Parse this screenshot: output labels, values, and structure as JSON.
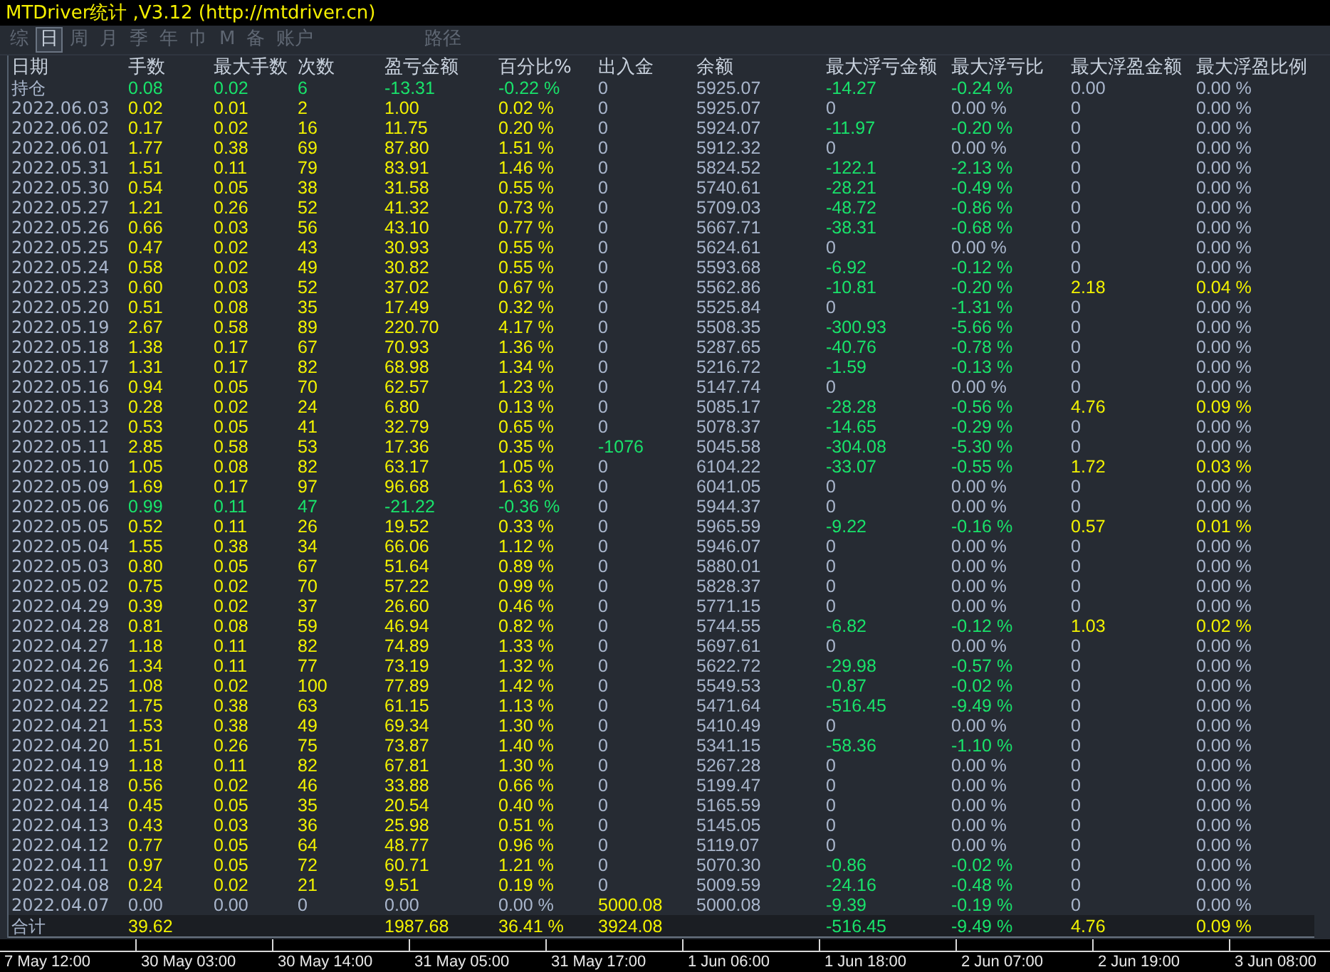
{
  "window": {
    "title": "MTDriver统计 ,V3.12 (http://mtdriver.cn)"
  },
  "toolbar": {
    "items": [
      {
        "label": "综",
        "selected": false
      },
      {
        "label": "日",
        "selected": true
      },
      {
        "label": "周",
        "selected": false
      },
      {
        "label": "月",
        "selected": false
      },
      {
        "label": "季",
        "selected": false
      },
      {
        "label": "年",
        "selected": false
      },
      {
        "label": "巾",
        "selected": false
      },
      {
        "label": "M",
        "selected": false
      },
      {
        "label": "备",
        "selected": false
      },
      {
        "label": "账户",
        "selected": false
      }
    ],
    "path_button": {
      "label": "路径",
      "selected": false
    }
  },
  "table": {
    "columns": [
      "日期",
      "手数",
      "最大手数",
      "次数",
      "盈亏金额",
      "百分比%",
      "出入金",
      "余额",
      "最大浮亏金额",
      "最大浮亏比",
      "最大浮盈金额",
      "最大浮盈比例"
    ],
    "rows": [
      {
        "cells": [
          {
            "text": "持仓"
          },
          {
            "text": "0.08",
            "color": "#19e36b"
          },
          {
            "text": "0.02",
            "color": "#19e36b"
          },
          {
            "text": "6",
            "color": "#19e36b"
          },
          {
            "text": "-13.31",
            "color": "#19e36b"
          },
          {
            "text": "-0.22 %",
            "color": "#19e36b"
          },
          {
            "text": "0"
          },
          {
            "text": "5925.07"
          },
          {
            "text": "-14.27",
            "color": "#19e36b"
          },
          {
            "text": "-0.24 %",
            "color": "#19e36b"
          },
          {
            "text": "0.00"
          },
          {
            "text": "0.00 %"
          }
        ]
      },
      {
        "cells": [
          {
            "text": "2022.06.03"
          },
          {
            "text": "0.02",
            "color": "#f2f200"
          },
          {
            "text": "0.01",
            "color": "#f2f200"
          },
          {
            "text": "2",
            "color": "#f2f200"
          },
          {
            "text": "1.00",
            "color": "#f2f200"
          },
          {
            "text": "0.02 %",
            "color": "#f2f200"
          },
          {
            "text": "0"
          },
          {
            "text": "5925.07"
          },
          {
            "text": "0"
          },
          {
            "text": "0.00 %"
          },
          {
            "text": "0"
          },
          {
            "text": "0.00 %"
          }
        ]
      },
      {
        "cells": [
          {
            "text": "2022.06.02"
          },
          {
            "text": "0.17",
            "color": "#f2f200"
          },
          {
            "text": "0.02",
            "color": "#f2f200"
          },
          {
            "text": "16",
            "color": "#f2f200"
          },
          {
            "text": "11.75",
            "color": "#f2f200"
          },
          {
            "text": "0.20 %",
            "color": "#f2f200"
          },
          {
            "text": "0"
          },
          {
            "text": "5924.07"
          },
          {
            "text": "-11.97",
            "color": "#19e36b"
          },
          {
            "text": "-0.20 %",
            "color": "#19e36b"
          },
          {
            "text": "0"
          },
          {
            "text": "0.00 %"
          }
        ]
      },
      {
        "cells": [
          {
            "text": "2022.06.01"
          },
          {
            "text": "1.77",
            "color": "#f2f200"
          },
          {
            "text": "0.38",
            "color": "#f2f200"
          },
          {
            "text": "69",
            "color": "#f2f200"
          },
          {
            "text": "87.80",
            "color": "#f2f200"
          },
          {
            "text": "1.51 %",
            "color": "#f2f200"
          },
          {
            "text": "0"
          },
          {
            "text": "5912.32"
          },
          {
            "text": "0"
          },
          {
            "text": "0.00 %"
          },
          {
            "text": "0"
          },
          {
            "text": "0.00 %"
          }
        ]
      },
      {
        "cells": [
          {
            "text": "2022.05.31"
          },
          {
            "text": "1.51",
            "color": "#f2f200"
          },
          {
            "text": "0.11",
            "color": "#f2f200"
          },
          {
            "text": "79",
            "color": "#f2f200"
          },
          {
            "text": "83.91",
            "color": "#f2f200"
          },
          {
            "text": "1.46 %",
            "color": "#f2f200"
          },
          {
            "text": "0"
          },
          {
            "text": "5824.52"
          },
          {
            "text": "-122.1",
            "color": "#19e36b"
          },
          {
            "text": "-2.13 %",
            "color": "#19e36b"
          },
          {
            "text": "0"
          },
          {
            "text": "0.00 %"
          }
        ]
      },
      {
        "cells": [
          {
            "text": "2022.05.30"
          },
          {
            "text": "0.54",
            "color": "#f2f200"
          },
          {
            "text": "0.05",
            "color": "#f2f200"
          },
          {
            "text": "38",
            "color": "#f2f200"
          },
          {
            "text": "31.58",
            "color": "#f2f200"
          },
          {
            "text": "0.55 %",
            "color": "#f2f200"
          },
          {
            "text": "0"
          },
          {
            "text": "5740.61"
          },
          {
            "text": "-28.21",
            "color": "#19e36b"
          },
          {
            "text": "-0.49 %",
            "color": "#19e36b"
          },
          {
            "text": "0"
          },
          {
            "text": "0.00 %"
          }
        ]
      },
      {
        "cells": [
          {
            "text": "2022.05.27"
          },
          {
            "text": "1.21",
            "color": "#f2f200"
          },
          {
            "text": "0.26",
            "color": "#f2f200"
          },
          {
            "text": "52",
            "color": "#f2f200"
          },
          {
            "text": "41.32",
            "color": "#f2f200"
          },
          {
            "text": "0.73 %",
            "color": "#f2f200"
          },
          {
            "text": "0"
          },
          {
            "text": "5709.03"
          },
          {
            "text": "-48.72",
            "color": "#19e36b"
          },
          {
            "text": "-0.86 %",
            "color": "#19e36b"
          },
          {
            "text": "0"
          },
          {
            "text": "0.00 %"
          }
        ]
      },
      {
        "cells": [
          {
            "text": "2022.05.26"
          },
          {
            "text": "0.66",
            "color": "#f2f200"
          },
          {
            "text": "0.03",
            "color": "#f2f200"
          },
          {
            "text": "56",
            "color": "#f2f200"
          },
          {
            "text": "43.10",
            "color": "#f2f200"
          },
          {
            "text": "0.77 %",
            "color": "#f2f200"
          },
          {
            "text": "0"
          },
          {
            "text": "5667.71"
          },
          {
            "text": "-38.31",
            "color": "#19e36b"
          },
          {
            "text": "-0.68 %",
            "color": "#19e36b"
          },
          {
            "text": "0"
          },
          {
            "text": "0.00 %"
          }
        ]
      },
      {
        "cells": [
          {
            "text": "2022.05.25"
          },
          {
            "text": "0.47",
            "color": "#f2f200"
          },
          {
            "text": "0.02",
            "color": "#f2f200"
          },
          {
            "text": "43",
            "color": "#f2f200"
          },
          {
            "text": "30.93",
            "color": "#f2f200"
          },
          {
            "text": "0.55 %",
            "color": "#f2f200"
          },
          {
            "text": "0"
          },
          {
            "text": "5624.61"
          },
          {
            "text": "0"
          },
          {
            "text": "0.00 %"
          },
          {
            "text": "0"
          },
          {
            "text": "0.00 %"
          }
        ]
      },
      {
        "cells": [
          {
            "text": "2022.05.24"
          },
          {
            "text": "0.58",
            "color": "#f2f200"
          },
          {
            "text": "0.02",
            "color": "#f2f200"
          },
          {
            "text": "49",
            "color": "#f2f200"
          },
          {
            "text": "30.82",
            "color": "#f2f200"
          },
          {
            "text": "0.55 %",
            "color": "#f2f200"
          },
          {
            "text": "0"
          },
          {
            "text": "5593.68"
          },
          {
            "text": "-6.92",
            "color": "#19e36b"
          },
          {
            "text": "-0.12 %",
            "color": "#19e36b"
          },
          {
            "text": "0"
          },
          {
            "text": "0.00 %"
          }
        ]
      },
      {
        "cells": [
          {
            "text": "2022.05.23"
          },
          {
            "text": "0.60",
            "color": "#f2f200"
          },
          {
            "text": "0.03",
            "color": "#f2f200"
          },
          {
            "text": "52",
            "color": "#f2f200"
          },
          {
            "text": "37.02",
            "color": "#f2f200"
          },
          {
            "text": "0.67 %",
            "color": "#f2f200"
          },
          {
            "text": "0"
          },
          {
            "text": "5562.86"
          },
          {
            "text": "-10.81",
            "color": "#19e36b"
          },
          {
            "text": "-0.20 %",
            "color": "#19e36b"
          },
          {
            "text": "2.18",
            "color": "#f2f200"
          },
          {
            "text": "0.04 %",
            "color": "#f2f200"
          }
        ]
      },
      {
        "cells": [
          {
            "text": "2022.05.20"
          },
          {
            "text": "0.51",
            "color": "#f2f200"
          },
          {
            "text": "0.08",
            "color": "#f2f200"
          },
          {
            "text": "35",
            "color": "#f2f200"
          },
          {
            "text": "17.49",
            "color": "#f2f200"
          },
          {
            "text": "0.32 %",
            "color": "#f2f200"
          },
          {
            "text": "0"
          },
          {
            "text": "5525.84"
          },
          {
            "text": "0"
          },
          {
            "text": "-1.31 %",
            "color": "#19e36b"
          },
          {
            "text": "0"
          },
          {
            "text": "0.00 %"
          }
        ]
      },
      {
        "cells": [
          {
            "text": "2022.05.19"
          },
          {
            "text": "2.67",
            "color": "#f2f200"
          },
          {
            "text": "0.58",
            "color": "#f2f200"
          },
          {
            "text": "89",
            "color": "#f2f200"
          },
          {
            "text": "220.70",
            "color": "#f2f200"
          },
          {
            "text": "4.17 %",
            "color": "#f2f200"
          },
          {
            "text": "0"
          },
          {
            "text": "5508.35"
          },
          {
            "text": "-300.93",
            "color": "#19e36b"
          },
          {
            "text": "-5.66 %",
            "color": "#19e36b"
          },
          {
            "text": "0"
          },
          {
            "text": "0.00 %"
          }
        ]
      },
      {
        "cells": [
          {
            "text": "2022.05.18"
          },
          {
            "text": "1.38",
            "color": "#f2f200"
          },
          {
            "text": "0.17",
            "color": "#f2f200"
          },
          {
            "text": "67",
            "color": "#f2f200"
          },
          {
            "text": "70.93",
            "color": "#f2f200"
          },
          {
            "text": "1.36 %",
            "color": "#f2f200"
          },
          {
            "text": "0"
          },
          {
            "text": "5287.65"
          },
          {
            "text": "-40.76",
            "color": "#19e36b"
          },
          {
            "text": "-0.78 %",
            "color": "#19e36b"
          },
          {
            "text": "0"
          },
          {
            "text": "0.00 %"
          }
        ]
      },
      {
        "cells": [
          {
            "text": "2022.05.17"
          },
          {
            "text": "1.31",
            "color": "#f2f200"
          },
          {
            "text": "0.17",
            "color": "#f2f200"
          },
          {
            "text": "82",
            "color": "#f2f200"
          },
          {
            "text": "68.98",
            "color": "#f2f200"
          },
          {
            "text": "1.34 %",
            "color": "#f2f200"
          },
          {
            "text": "0"
          },
          {
            "text": "5216.72"
          },
          {
            "text": "-1.59",
            "color": "#19e36b"
          },
          {
            "text": "-0.13 %",
            "color": "#19e36b"
          },
          {
            "text": "0"
          },
          {
            "text": "0.00 %"
          }
        ]
      },
      {
        "cells": [
          {
            "text": "2022.05.16"
          },
          {
            "text": "0.94",
            "color": "#f2f200"
          },
          {
            "text": "0.05",
            "color": "#f2f200"
          },
          {
            "text": "70",
            "color": "#f2f200"
          },
          {
            "text": "62.57",
            "color": "#f2f200"
          },
          {
            "text": "1.23 %",
            "color": "#f2f200"
          },
          {
            "text": "0"
          },
          {
            "text": "5147.74"
          },
          {
            "text": "0"
          },
          {
            "text": "0.00 %"
          },
          {
            "text": "0"
          },
          {
            "text": "0.00 %"
          }
        ]
      },
      {
        "cells": [
          {
            "text": "2022.05.13"
          },
          {
            "text": "0.28",
            "color": "#f2f200"
          },
          {
            "text": "0.02",
            "color": "#f2f200"
          },
          {
            "text": "24",
            "color": "#f2f200"
          },
          {
            "text": "6.80",
            "color": "#f2f200"
          },
          {
            "text": "0.13 %",
            "color": "#f2f200"
          },
          {
            "text": "0"
          },
          {
            "text": "5085.17"
          },
          {
            "text": "-28.28",
            "color": "#19e36b"
          },
          {
            "text": "-0.56 %",
            "color": "#19e36b"
          },
          {
            "text": "4.76",
            "color": "#f2f200"
          },
          {
            "text": "0.09 %",
            "color": "#f2f200"
          }
        ]
      },
      {
        "cells": [
          {
            "text": "2022.05.12"
          },
          {
            "text": "0.53",
            "color": "#f2f200"
          },
          {
            "text": "0.05",
            "color": "#f2f200"
          },
          {
            "text": "41",
            "color": "#f2f200"
          },
          {
            "text": "32.79",
            "color": "#f2f200"
          },
          {
            "text": "0.65 %",
            "color": "#f2f200"
          },
          {
            "text": "0"
          },
          {
            "text": "5078.37"
          },
          {
            "text": "-14.65",
            "color": "#19e36b"
          },
          {
            "text": "-0.29 %",
            "color": "#19e36b"
          },
          {
            "text": "0"
          },
          {
            "text": "0.00 %"
          }
        ]
      },
      {
        "cells": [
          {
            "text": "2022.05.11"
          },
          {
            "text": "2.85",
            "color": "#f2f200"
          },
          {
            "text": "0.58",
            "color": "#f2f200"
          },
          {
            "text": "53",
            "color": "#f2f200"
          },
          {
            "text": "17.36",
            "color": "#f2f200"
          },
          {
            "text": "0.35 %",
            "color": "#f2f200"
          },
          {
            "text": "-1076",
            "color": "#19e36b"
          },
          {
            "text": "5045.58"
          },
          {
            "text": "-304.08",
            "color": "#19e36b"
          },
          {
            "text": "-5.30 %",
            "color": "#19e36b"
          },
          {
            "text": "0"
          },
          {
            "text": "0.00 %"
          }
        ]
      },
      {
        "cells": [
          {
            "text": "2022.05.10"
          },
          {
            "text": "1.05",
            "color": "#f2f200"
          },
          {
            "text": "0.08",
            "color": "#f2f200"
          },
          {
            "text": "82",
            "color": "#f2f200"
          },
          {
            "text": "63.17",
            "color": "#f2f200"
          },
          {
            "text": "1.05 %",
            "color": "#f2f200"
          },
          {
            "text": "0"
          },
          {
            "text": "6104.22"
          },
          {
            "text": "-33.07",
            "color": "#19e36b"
          },
          {
            "text": "-0.55 %",
            "color": "#19e36b"
          },
          {
            "text": "1.72",
            "color": "#f2f200"
          },
          {
            "text": "0.03 %",
            "color": "#f2f200"
          }
        ]
      },
      {
        "cells": [
          {
            "text": "2022.05.09"
          },
          {
            "text": "1.69",
            "color": "#f2f200"
          },
          {
            "text": "0.17",
            "color": "#f2f200"
          },
          {
            "text": "97",
            "color": "#f2f200"
          },
          {
            "text": "96.68",
            "color": "#f2f200"
          },
          {
            "text": "1.63 %",
            "color": "#f2f200"
          },
          {
            "text": "0"
          },
          {
            "text": "6041.05"
          },
          {
            "text": "0"
          },
          {
            "text": "0.00 %"
          },
          {
            "text": "0"
          },
          {
            "text": "0.00 %"
          }
        ]
      },
      {
        "cells": [
          {
            "text": "2022.05.06"
          },
          {
            "text": "0.99",
            "color": "#19e36b"
          },
          {
            "text": "0.11",
            "color": "#19e36b"
          },
          {
            "text": "47",
            "color": "#19e36b"
          },
          {
            "text": "-21.22",
            "color": "#19e36b"
          },
          {
            "text": "-0.36 %",
            "color": "#19e36b"
          },
          {
            "text": "0"
          },
          {
            "text": "5944.37"
          },
          {
            "text": "0"
          },
          {
            "text": "0.00 %"
          },
          {
            "text": "0"
          },
          {
            "text": "0.00 %"
          }
        ]
      },
      {
        "cells": [
          {
            "text": "2022.05.05"
          },
          {
            "text": "0.52",
            "color": "#f2f200"
          },
          {
            "text": "0.11",
            "color": "#f2f200"
          },
          {
            "text": "26",
            "color": "#f2f200"
          },
          {
            "text": "19.52",
            "color": "#f2f200"
          },
          {
            "text": "0.33 %",
            "color": "#f2f200"
          },
          {
            "text": "0"
          },
          {
            "text": "5965.59"
          },
          {
            "text": "-9.22",
            "color": "#19e36b"
          },
          {
            "text": "-0.16 %",
            "color": "#19e36b"
          },
          {
            "text": "0.57",
            "color": "#f2f200"
          },
          {
            "text": "0.01 %",
            "color": "#f2f200"
          }
        ]
      },
      {
        "cells": [
          {
            "text": "2022.05.04"
          },
          {
            "text": "1.55",
            "color": "#f2f200"
          },
          {
            "text": "0.38",
            "color": "#f2f200"
          },
          {
            "text": "34",
            "color": "#f2f200"
          },
          {
            "text": "66.06",
            "color": "#f2f200"
          },
          {
            "text": "1.12 %",
            "color": "#f2f200"
          },
          {
            "text": "0"
          },
          {
            "text": "5946.07"
          },
          {
            "text": "0"
          },
          {
            "text": "0.00 %"
          },
          {
            "text": "0"
          },
          {
            "text": "0.00 %"
          }
        ]
      },
      {
        "cells": [
          {
            "text": "2022.05.03"
          },
          {
            "text": "0.80",
            "color": "#f2f200"
          },
          {
            "text": "0.05",
            "color": "#f2f200"
          },
          {
            "text": "67",
            "color": "#f2f200"
          },
          {
            "text": "51.64",
            "color": "#f2f200"
          },
          {
            "text": "0.89 %",
            "color": "#f2f200"
          },
          {
            "text": "0"
          },
          {
            "text": "5880.01"
          },
          {
            "text": "0"
          },
          {
            "text": "0.00 %"
          },
          {
            "text": "0"
          },
          {
            "text": "0.00 %"
          }
        ]
      },
      {
        "cells": [
          {
            "text": "2022.05.02"
          },
          {
            "text": "0.75",
            "color": "#f2f200"
          },
          {
            "text": "0.02",
            "color": "#f2f200"
          },
          {
            "text": "70",
            "color": "#f2f200"
          },
          {
            "text": "57.22",
            "color": "#f2f200"
          },
          {
            "text": "0.99 %",
            "color": "#f2f200"
          },
          {
            "text": "0"
          },
          {
            "text": "5828.37"
          },
          {
            "text": "0"
          },
          {
            "text": "0.00 %"
          },
          {
            "text": "0"
          },
          {
            "text": "0.00 %"
          }
        ]
      },
      {
        "cells": [
          {
            "text": "2022.04.29"
          },
          {
            "text": "0.39",
            "color": "#f2f200"
          },
          {
            "text": "0.02",
            "color": "#f2f200"
          },
          {
            "text": "37",
            "color": "#f2f200"
          },
          {
            "text": "26.60",
            "color": "#f2f200"
          },
          {
            "text": "0.46 %",
            "color": "#f2f200"
          },
          {
            "text": "0"
          },
          {
            "text": "5771.15"
          },
          {
            "text": "0"
          },
          {
            "text": "0.00 %"
          },
          {
            "text": "0"
          },
          {
            "text": "0.00 %"
          }
        ]
      },
      {
        "cells": [
          {
            "text": "2022.04.28"
          },
          {
            "text": "0.81",
            "color": "#f2f200"
          },
          {
            "text": "0.08",
            "color": "#f2f200"
          },
          {
            "text": "59",
            "color": "#f2f200"
          },
          {
            "text": "46.94",
            "color": "#f2f200"
          },
          {
            "text": "0.82 %",
            "color": "#f2f200"
          },
          {
            "text": "0"
          },
          {
            "text": "5744.55"
          },
          {
            "text": "-6.82",
            "color": "#19e36b"
          },
          {
            "text": "-0.12 %",
            "color": "#19e36b"
          },
          {
            "text": "1.03",
            "color": "#f2f200"
          },
          {
            "text": "0.02 %",
            "color": "#f2f200"
          }
        ]
      },
      {
        "cells": [
          {
            "text": "2022.04.27"
          },
          {
            "text": "1.18",
            "color": "#f2f200"
          },
          {
            "text": "0.11",
            "color": "#f2f200"
          },
          {
            "text": "82",
            "color": "#f2f200"
          },
          {
            "text": "74.89",
            "color": "#f2f200"
          },
          {
            "text": "1.33 %",
            "color": "#f2f200"
          },
          {
            "text": "0"
          },
          {
            "text": "5697.61"
          },
          {
            "text": "0"
          },
          {
            "text": "0.00 %"
          },
          {
            "text": "0"
          },
          {
            "text": "0.00 %"
          }
        ]
      },
      {
        "cells": [
          {
            "text": "2022.04.26"
          },
          {
            "text": "1.34",
            "color": "#f2f200"
          },
          {
            "text": "0.11",
            "color": "#f2f200"
          },
          {
            "text": "77",
            "color": "#f2f200"
          },
          {
            "text": "73.19",
            "color": "#f2f200"
          },
          {
            "text": "1.32 %",
            "color": "#f2f200"
          },
          {
            "text": "0"
          },
          {
            "text": "5622.72"
          },
          {
            "text": "-29.98",
            "color": "#19e36b"
          },
          {
            "text": "-0.57 %",
            "color": "#19e36b"
          },
          {
            "text": "0"
          },
          {
            "text": "0.00 %"
          }
        ]
      },
      {
        "cells": [
          {
            "text": "2022.04.25"
          },
          {
            "text": "1.08",
            "color": "#f2f200"
          },
          {
            "text": "0.02",
            "color": "#f2f200"
          },
          {
            "text": "100",
            "color": "#f2f200"
          },
          {
            "text": "77.89",
            "color": "#f2f200"
          },
          {
            "text": "1.42 %",
            "color": "#f2f200"
          },
          {
            "text": "0"
          },
          {
            "text": "5549.53"
          },
          {
            "text": "-0.87",
            "color": "#19e36b"
          },
          {
            "text": "-0.02 %",
            "color": "#19e36b"
          },
          {
            "text": "0"
          },
          {
            "text": "0.00 %"
          }
        ]
      },
      {
        "cells": [
          {
            "text": "2022.04.22"
          },
          {
            "text": "1.75",
            "color": "#f2f200"
          },
          {
            "text": "0.38",
            "color": "#f2f200"
          },
          {
            "text": "63",
            "color": "#f2f200"
          },
          {
            "text": "61.15",
            "color": "#f2f200"
          },
          {
            "text": "1.13 %",
            "color": "#f2f200"
          },
          {
            "text": "0"
          },
          {
            "text": "5471.64"
          },
          {
            "text": "-516.45",
            "color": "#19e36b"
          },
          {
            "text": "-9.49 %",
            "color": "#19e36b"
          },
          {
            "text": "0"
          },
          {
            "text": "0.00 %"
          }
        ]
      },
      {
        "cells": [
          {
            "text": "2022.04.21"
          },
          {
            "text": "1.53",
            "color": "#f2f200"
          },
          {
            "text": "0.38",
            "color": "#f2f200"
          },
          {
            "text": "49",
            "color": "#f2f200"
          },
          {
            "text": "69.34",
            "color": "#f2f200"
          },
          {
            "text": "1.30 %",
            "color": "#f2f200"
          },
          {
            "text": "0"
          },
          {
            "text": "5410.49"
          },
          {
            "text": "0"
          },
          {
            "text": "0.00 %"
          },
          {
            "text": "0"
          },
          {
            "text": "0.00 %"
          }
        ]
      },
      {
        "cells": [
          {
            "text": "2022.04.20"
          },
          {
            "text": "1.51",
            "color": "#f2f200"
          },
          {
            "text": "0.26",
            "color": "#f2f200"
          },
          {
            "text": "75",
            "color": "#f2f200"
          },
          {
            "text": "73.87",
            "color": "#f2f200"
          },
          {
            "text": "1.40 %",
            "color": "#f2f200"
          },
          {
            "text": "0"
          },
          {
            "text": "5341.15"
          },
          {
            "text": "-58.36",
            "color": "#19e36b"
          },
          {
            "text": "-1.10 %",
            "color": "#19e36b"
          },
          {
            "text": "0"
          },
          {
            "text": "0.00 %"
          }
        ]
      },
      {
        "cells": [
          {
            "text": "2022.04.19"
          },
          {
            "text": "1.18",
            "color": "#f2f200"
          },
          {
            "text": "0.11",
            "color": "#f2f200"
          },
          {
            "text": "82",
            "color": "#f2f200"
          },
          {
            "text": "67.81",
            "color": "#f2f200"
          },
          {
            "text": "1.30 %",
            "color": "#f2f200"
          },
          {
            "text": "0"
          },
          {
            "text": "5267.28"
          },
          {
            "text": "0"
          },
          {
            "text": "0.00 %"
          },
          {
            "text": "0"
          },
          {
            "text": "0.00 %"
          }
        ]
      },
      {
        "cells": [
          {
            "text": "2022.04.18"
          },
          {
            "text": "0.56",
            "color": "#f2f200"
          },
          {
            "text": "0.02",
            "color": "#f2f200"
          },
          {
            "text": "46",
            "color": "#f2f200"
          },
          {
            "text": "33.88",
            "color": "#f2f200"
          },
          {
            "text": "0.66 %",
            "color": "#f2f200"
          },
          {
            "text": "0"
          },
          {
            "text": "5199.47"
          },
          {
            "text": "0"
          },
          {
            "text": "0.00 %"
          },
          {
            "text": "0"
          },
          {
            "text": "0.00 %"
          }
        ]
      },
      {
        "cells": [
          {
            "text": "2022.04.14"
          },
          {
            "text": "0.45",
            "color": "#f2f200"
          },
          {
            "text": "0.05",
            "color": "#f2f200"
          },
          {
            "text": "35",
            "color": "#f2f200"
          },
          {
            "text": "20.54",
            "color": "#f2f200"
          },
          {
            "text": "0.40 %",
            "color": "#f2f200"
          },
          {
            "text": "0"
          },
          {
            "text": "5165.59"
          },
          {
            "text": "0"
          },
          {
            "text": "0.00 %"
          },
          {
            "text": "0"
          },
          {
            "text": "0.00 %"
          }
        ]
      },
      {
        "cells": [
          {
            "text": "2022.04.13"
          },
          {
            "text": "0.43",
            "color": "#f2f200"
          },
          {
            "text": "0.03",
            "color": "#f2f200"
          },
          {
            "text": "36",
            "color": "#f2f200"
          },
          {
            "text": "25.98",
            "color": "#f2f200"
          },
          {
            "text": "0.51 %",
            "color": "#f2f200"
          },
          {
            "text": "0"
          },
          {
            "text": "5145.05"
          },
          {
            "text": "0"
          },
          {
            "text": "0.00 %"
          },
          {
            "text": "0"
          },
          {
            "text": "0.00 %"
          }
        ]
      },
      {
        "cells": [
          {
            "text": "2022.04.12"
          },
          {
            "text": "0.77",
            "color": "#f2f200"
          },
          {
            "text": "0.05",
            "color": "#f2f200"
          },
          {
            "text": "64",
            "color": "#f2f200"
          },
          {
            "text": "48.77",
            "color": "#f2f200"
          },
          {
            "text": "0.96 %",
            "color": "#f2f200"
          },
          {
            "text": "0"
          },
          {
            "text": "5119.07"
          },
          {
            "text": "0"
          },
          {
            "text": "0.00 %"
          },
          {
            "text": "0"
          },
          {
            "text": "0.00 %"
          }
        ]
      },
      {
        "cells": [
          {
            "text": "2022.04.11"
          },
          {
            "text": "0.97",
            "color": "#f2f200"
          },
          {
            "text": "0.05",
            "color": "#f2f200"
          },
          {
            "text": "72",
            "color": "#f2f200"
          },
          {
            "text": "60.71",
            "color": "#f2f200"
          },
          {
            "text": "1.21 %",
            "color": "#f2f200"
          },
          {
            "text": "0"
          },
          {
            "text": "5070.30"
          },
          {
            "text": "-0.86",
            "color": "#19e36b"
          },
          {
            "text": "-0.02 %",
            "color": "#19e36b"
          },
          {
            "text": "0"
          },
          {
            "text": "0.00 %"
          }
        ]
      },
      {
        "cells": [
          {
            "text": "2022.04.08"
          },
          {
            "text": "0.24",
            "color": "#f2f200"
          },
          {
            "text": "0.02",
            "color": "#f2f200"
          },
          {
            "text": "21",
            "color": "#f2f200"
          },
          {
            "text": "9.51",
            "color": "#f2f200"
          },
          {
            "text": "0.19 %",
            "color": "#f2f200"
          },
          {
            "text": "0"
          },
          {
            "text": "5009.59"
          },
          {
            "text": "-24.16",
            "color": "#19e36b"
          },
          {
            "text": "-0.48 %",
            "color": "#19e36b"
          },
          {
            "text": "0"
          },
          {
            "text": "0.00 %"
          }
        ]
      },
      {
        "cells": [
          {
            "text": "2022.04.07"
          },
          {
            "text": "0.00"
          },
          {
            "text": "0.00"
          },
          {
            "text": "0"
          },
          {
            "text": "0.00"
          },
          {
            "text": "0.00 %"
          },
          {
            "text": "5000.08",
            "color": "#f2f200"
          },
          {
            "text": "5000.08"
          },
          {
            "text": "-9.39",
            "color": "#19e36b"
          },
          {
            "text": "-0.19 %",
            "color": "#19e36b"
          },
          {
            "text": "0"
          },
          {
            "text": "0.00 %"
          }
        ]
      },
      {
        "total": true,
        "cells": [
          {
            "text": "合计"
          },
          {
            "text": "39.62",
            "color": "#f2f200"
          },
          {
            "text": ""
          },
          {
            "text": ""
          },
          {
            "text": "1987.68",
            "color": "#f2f200"
          },
          {
            "text": "36.41 %",
            "color": "#f2f200"
          },
          {
            "text": "3924.08",
            "color": "#f2f200"
          },
          {
            "text": ""
          },
          {
            "text": "-516.45",
            "color": "#19e36b"
          },
          {
            "text": "-9.49 %",
            "color": "#19e36b"
          },
          {
            "text": "4.76",
            "color": "#f2f200"
          },
          {
            "text": "0.09 %",
            "color": "#f2f200"
          }
        ]
      }
    ]
  },
  "time_axis": {
    "labels": [
      "7 May 12:00",
      "30 May 03:00",
      "30 May 14:00",
      "31 May 05:00",
      "31 May 17:00",
      "1 Jun 06:00",
      "1 Jun 18:00",
      "2 Jun 07:00",
      "2 Jun 19:00",
      "3 Jun 08:00"
    ]
  }
}
